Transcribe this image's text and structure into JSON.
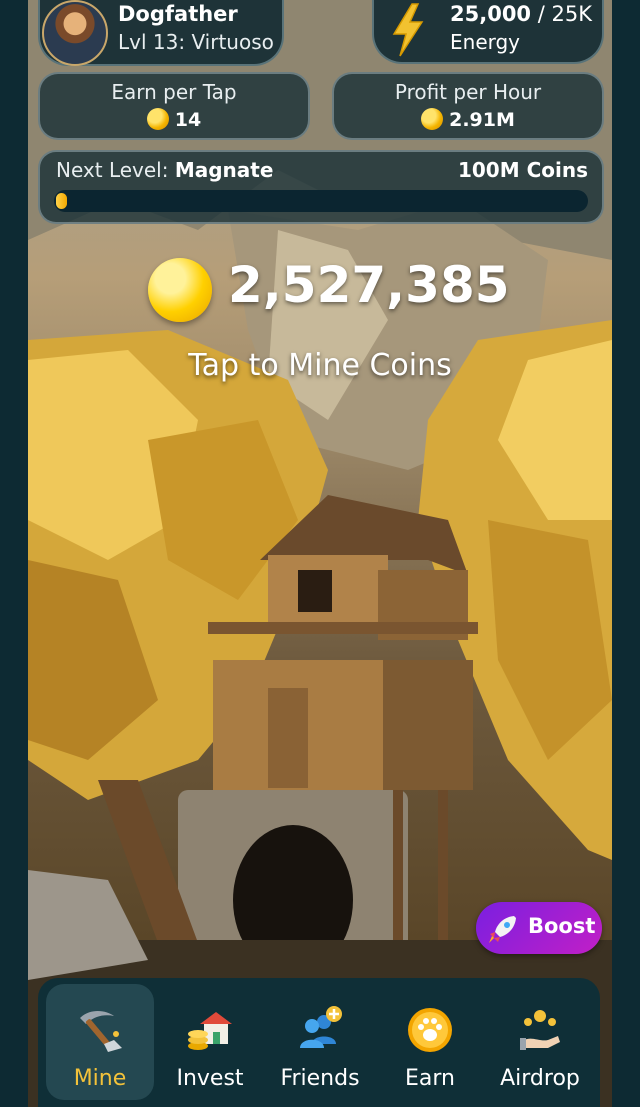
{
  "profile": {
    "name": "Dogfather",
    "level": "Lvl 13: Virtuoso",
    "avatar_icon": "dog-in-suit-avatar"
  },
  "energy": {
    "current": "25,000",
    "separator": "/",
    "max": "25K",
    "label": "Energy",
    "icon": "lightning-icon"
  },
  "stats": {
    "earn_per_tap": {
      "title": "Earn per Tap",
      "value": "14"
    },
    "profit_per_hour": {
      "title": "Profit per Hour",
      "value": "2.91M"
    }
  },
  "level": {
    "prefix": "Next Level:",
    "name": "Magnate",
    "goal": "100M Coins",
    "progress": 0.02
  },
  "balance": {
    "value": "2,527,385"
  },
  "tap_hint": "Tap to Mine Coins",
  "boost": {
    "label": "Boost",
    "icon": "rocket-icon"
  },
  "nav": [
    {
      "label": "Mine",
      "icon": "pickaxe-icon",
      "active": true
    },
    {
      "label": "Invest",
      "icon": "house-coins-icon",
      "active": false
    },
    {
      "label": "Friends",
      "icon": "add-friends-icon",
      "active": false
    },
    {
      "label": "Earn",
      "icon": "paw-coin-icon",
      "active": false
    },
    {
      "label": "Airdrop",
      "icon": "airdrop-coins-icon",
      "active": false
    }
  ],
  "colors": {
    "accent_gold": "#f3c23a",
    "background": "#0d2a33",
    "boost": "#9b1fd6"
  }
}
